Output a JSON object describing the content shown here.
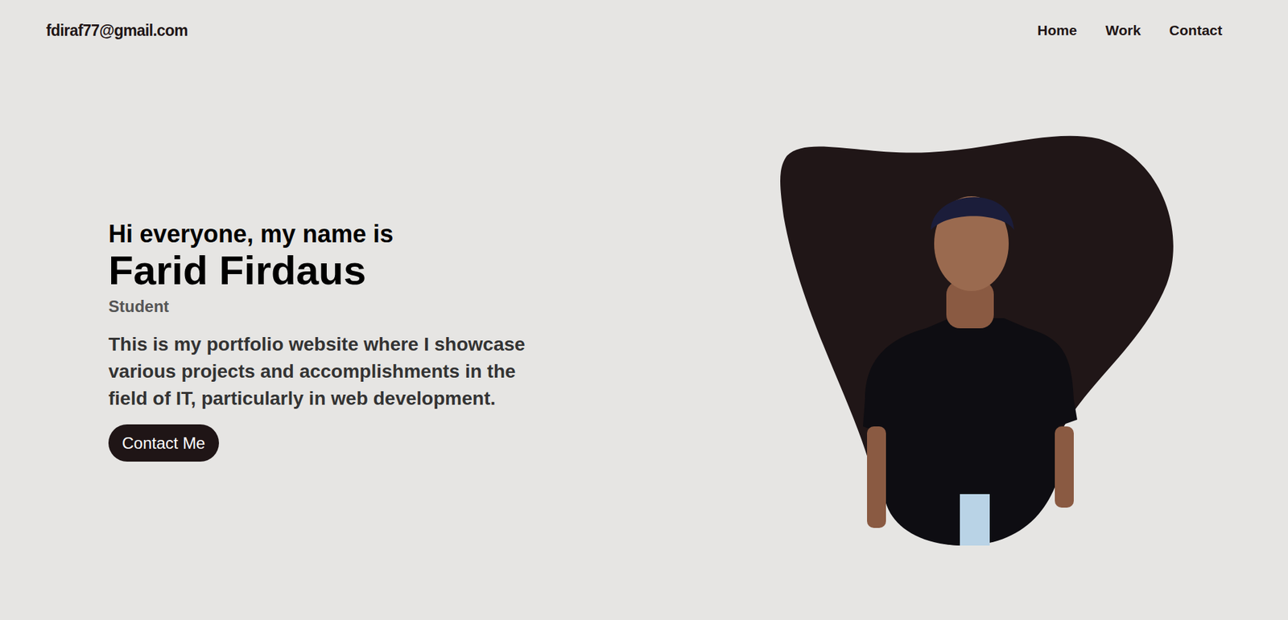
{
  "header": {
    "email": "fdiraf77@gmail.com"
  },
  "nav": [
    {
      "label": "Home"
    },
    {
      "label": "Work"
    },
    {
      "label": "Contact"
    }
  ],
  "hero": {
    "greeting": "Hi everyone, my name is",
    "name": "Farid Firdaus",
    "role": "Student",
    "description": "This is my portfolio website where I showcase various projects and accomplishments in the field of IT, particularly in web development.",
    "button": "Contact Me"
  }
}
